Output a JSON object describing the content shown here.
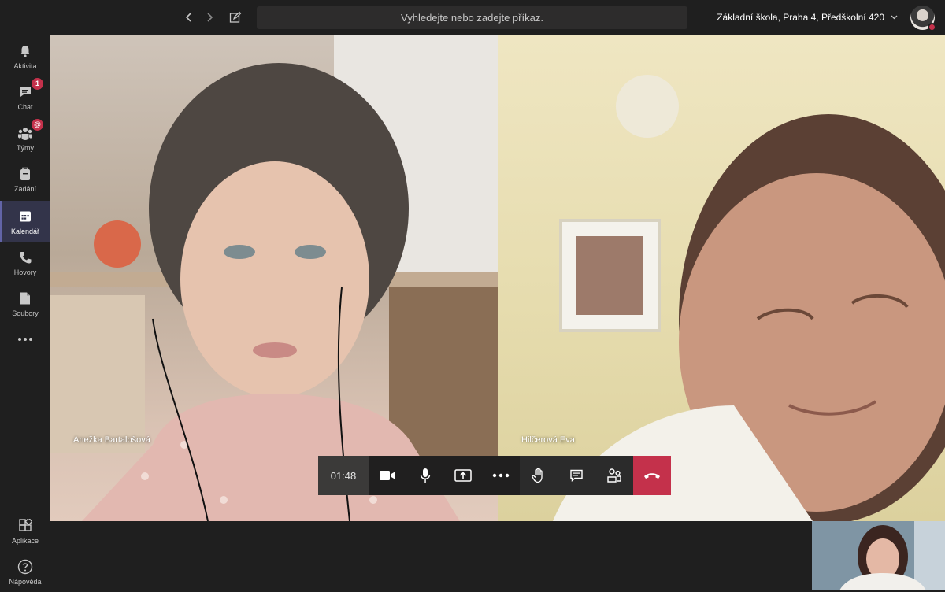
{
  "search": {
    "placeholder": "Vyhledejte nebo zadejte příkaz."
  },
  "header": {
    "org_name": "Základní škola, Praha 4, Předškolní 420"
  },
  "rail": {
    "items": [
      {
        "label": "Aktivita",
        "icon": "bell-icon"
      },
      {
        "label": "Chat",
        "icon": "chat-icon",
        "badge": "1"
      },
      {
        "label": "Týmy",
        "icon": "teams-icon",
        "badge": "@"
      },
      {
        "label": "Zadání",
        "icon": "assignments-icon"
      },
      {
        "label": "Kalendář",
        "icon": "calendar-icon",
        "active": true
      },
      {
        "label": "Hovory",
        "icon": "phone-icon"
      },
      {
        "label": "Soubory",
        "icon": "files-icon"
      },
      {
        "label": "…",
        "icon": "more-icon"
      }
    ],
    "bottom": [
      {
        "label": "Aplikace",
        "icon": "apps-icon"
      },
      {
        "label": "Nápověda",
        "icon": "help-icon"
      }
    ]
  },
  "call": {
    "participants": [
      {
        "name": "Anežka Bartalošová"
      },
      {
        "name": "Hilčerová Eva"
      }
    ],
    "timer": "01:48",
    "controls": [
      "camera-icon",
      "microphone-icon",
      "share-screen-icon",
      "more-options-icon",
      "raise-hand-icon",
      "chat-icon",
      "participants-icon",
      "hang-up-icon"
    ]
  },
  "colors": {
    "accent": "#6264a7",
    "hangup": "#c4314b",
    "background": "#1f1f1f"
  }
}
